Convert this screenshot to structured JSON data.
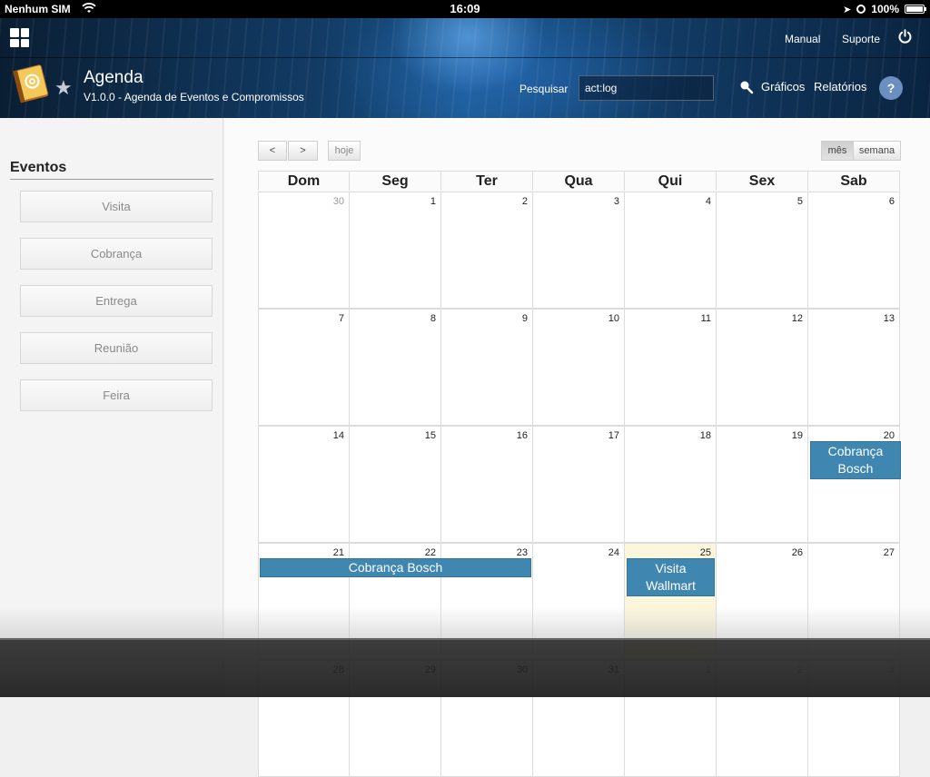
{
  "status": {
    "carrier": "Nenhum SIM",
    "time": "16:09",
    "battery": "100%",
    "battery_level": 1.0
  },
  "header": {
    "links": {
      "manual": "Manual",
      "suporte": "Suporte"
    },
    "app_title": "Agenda",
    "app_subtitle": "V1.0.0 - Agenda de Eventos e Compromissos",
    "search_label": "Pesquisar",
    "search_value": "act:log",
    "graficos": "Gráficos",
    "relatorios": "Relatórios",
    "help": "?"
  },
  "sidebar": {
    "title": "Eventos",
    "items": [
      "Visita",
      "Cobrança",
      "Entrega",
      "Reunião",
      "Feira"
    ]
  },
  "toolbar": {
    "prev": "<",
    "next": ">",
    "today": "hoje",
    "month": "mês",
    "week": "semana",
    "active_view": "mês"
  },
  "calendar": {
    "days": [
      "Dom",
      "Seg",
      "Ter",
      "Qua",
      "Qui",
      "Sex",
      "Sab"
    ],
    "weeks": [
      [
        {
          "d": "30",
          "other": true
        },
        {
          "d": "1"
        },
        {
          "d": "2"
        },
        {
          "d": "3"
        },
        {
          "d": "4"
        },
        {
          "d": "5"
        },
        {
          "d": "6"
        }
      ],
      [
        {
          "d": "7"
        },
        {
          "d": "8"
        },
        {
          "d": "9"
        },
        {
          "d": "10"
        },
        {
          "d": "11"
        },
        {
          "d": "12"
        },
        {
          "d": "13"
        }
      ],
      [
        {
          "d": "14"
        },
        {
          "d": "15"
        },
        {
          "d": "16"
        },
        {
          "d": "17"
        },
        {
          "d": "18"
        },
        {
          "d": "19"
        },
        {
          "d": "20"
        }
      ],
      [
        {
          "d": "21"
        },
        {
          "d": "22"
        },
        {
          "d": "23"
        },
        {
          "d": "24"
        },
        {
          "d": "25",
          "today": true
        },
        {
          "d": "26"
        },
        {
          "d": "27"
        }
      ],
      [
        {
          "d": "28"
        },
        {
          "d": "29"
        },
        {
          "d": "30"
        },
        {
          "d": "31"
        },
        {
          "d": "1",
          "other": true
        },
        {
          "d": "2",
          "other": true
        },
        {
          "d": "3",
          "other": true
        }
      ]
    ],
    "events": [
      {
        "title": "Cobrança Bosch",
        "week": 2,
        "start": 6,
        "span": 1
      },
      {
        "title": "Cobrança Bosch",
        "week": 3,
        "start": 0,
        "span": 3
      },
      {
        "title": "Visita Wallmart",
        "week": 3,
        "start": 4,
        "span": 1
      }
    ]
  },
  "colors": {
    "event": "#3f86b0",
    "today": "#fcf7dc",
    "header": "#123c66"
  }
}
